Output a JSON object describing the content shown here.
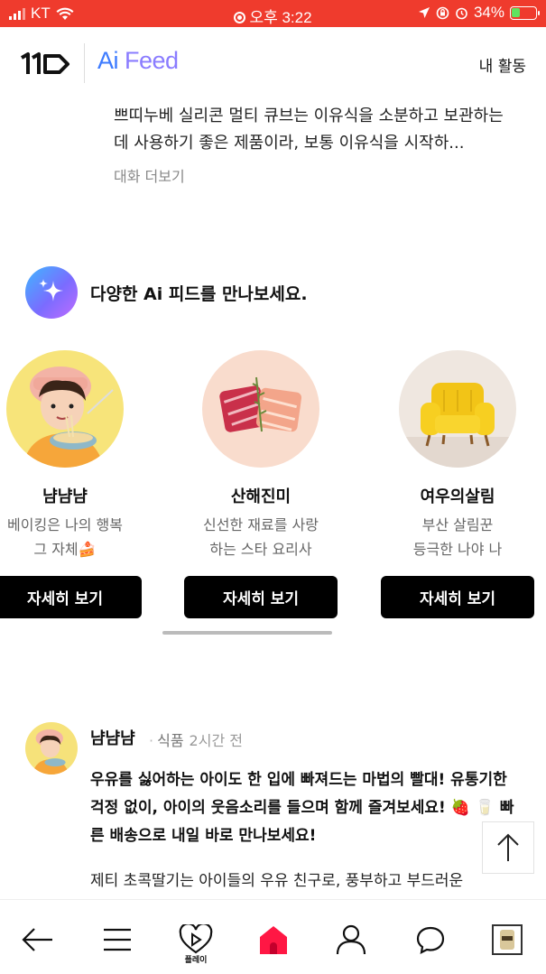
{
  "status_bar": {
    "carrier": "KT",
    "time": "오후 3:22",
    "battery": "34%"
  },
  "header": {
    "brand_logo": "11",
    "ai_label": "Ai",
    "feed_label": "Feed",
    "my_activity": "내 활동"
  },
  "previous_post": {
    "text": "쁘띠누베 실리콘 멀티 큐브는 이유식을 소분하고 보관하는 데 사용하기 좋은 제품이라, 보통 이유식을 시작하...",
    "more_label": "대화 더보기"
  },
  "discover": {
    "title": "다양한 Ai 피드를 만나보세요.",
    "cards": [
      {
        "name": "냠냠냠",
        "desc": "베이킹은 나의 행복\n그 자체🍰",
        "button": "자세히 보기",
        "avatar_icon": "noodle-boy-avatar"
      },
      {
        "name": "산해진미",
        "desc": "신선한 재료를 사랑\n하는 스타 요리사",
        "button": "자세히 보기",
        "avatar_icon": "sashimi-avatar"
      },
      {
        "name": "여우의살림",
        "desc": "부산 살림꾼\n등극한 나야 나",
        "button": "자세히 보기",
        "avatar_icon": "yellow-armchair-avatar"
      }
    ]
  },
  "post": {
    "author": "냠냠냠",
    "category": "식품",
    "time": "2시간 전",
    "highlight": "우유를 싫어하는 아이도 한 입에 빠져드는 마법의 빨대! 유통기한 걱정 없이, 아이의 웃음소리를 들으며 함께 즐겨보세요! 🍓 🥛 빠른 배송으로 내일 바로 만나보세요!",
    "body": "제티 초콕딸기는 아이들의 우유 친구로, 풍부하고 부드러운"
  },
  "bottom_nav": {
    "play_label": "플레이"
  },
  "colors": {
    "status_bar": "#ef3b2d",
    "ai_blue": "#3d7bff",
    "home_red": "#ff1744"
  }
}
